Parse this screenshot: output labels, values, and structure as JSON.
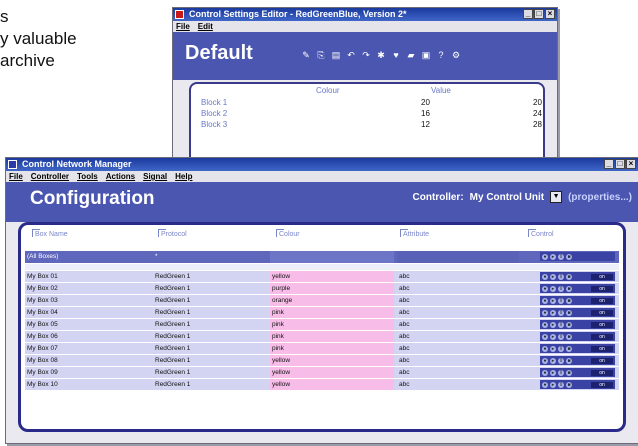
{
  "background_text": "s\ny valuable\narchive",
  "back_window": {
    "title": "Control Settings Editor - RedGreenBlue, Version 2*",
    "menu": [
      "File",
      "Edit"
    ],
    "heading": "Default",
    "column_headers": [
      "Colour",
      "Value"
    ],
    "rows": [
      {
        "name": "Block 1",
        "a": "20",
        "b": "20"
      },
      {
        "name": "Block 2",
        "a": "16",
        "b": "24"
      },
      {
        "name": "Block 3",
        "a": "12",
        "b": "28"
      }
    ]
  },
  "front_window": {
    "title": "Control Network Manager",
    "menu": [
      "File",
      "Controller",
      "Tools",
      "Actions",
      "Signal",
      "Help"
    ],
    "heading": "Configuration",
    "controller_label": "Controller:",
    "controller_value": "My Control Unit",
    "properties_link": "(properties...)",
    "columns": [
      "Box Name",
      "Protocol",
      "Colour",
      "Attribute",
      "Control"
    ],
    "all_row": {
      "name": "(All Boxes)",
      "protocol": "*"
    },
    "rows": [
      {
        "name": "My Box 01",
        "protocol": "RedGreen 1",
        "colour": "yellow",
        "attribute": "abc"
      },
      {
        "name": "My Box 02",
        "protocol": "RedGreen 1",
        "colour": "purple",
        "attribute": "abc"
      },
      {
        "name": "My Box 03",
        "protocol": "RedGreen 1",
        "colour": "orange",
        "attribute": "abc"
      },
      {
        "name": "My Box 04",
        "protocol": "RedGreen 1",
        "colour": "pink",
        "attribute": "abc"
      },
      {
        "name": "My Box 05",
        "protocol": "RedGreen 1",
        "colour": "pink",
        "attribute": "abc"
      },
      {
        "name": "My Box 06",
        "protocol": "RedGreen 1",
        "colour": "pink",
        "attribute": "abc"
      },
      {
        "name": "My Box 07",
        "protocol": "RedGreen 1",
        "colour": "pink",
        "attribute": "abc"
      },
      {
        "name": "My Box 08",
        "protocol": "RedGreen 1",
        "colour": "yellow",
        "attribute": "abc"
      },
      {
        "name": "My Box 09",
        "protocol": "RedGreen 1",
        "colour": "yellow",
        "attribute": "abc"
      },
      {
        "name": "My Box 10",
        "protocol": "RedGreen 1",
        "colour": "yellow",
        "attribute": "abc"
      }
    ],
    "row_button_label": "on"
  },
  "icons": [
    "app-icon",
    "minimize-icon",
    "maximize-icon",
    "close-icon",
    "dropdown-arrow-icon"
  ],
  "colors": {
    "accent": "#4a56b0",
    "colour_cell": "#f7bde8",
    "row": "#d2d4f2"
  }
}
